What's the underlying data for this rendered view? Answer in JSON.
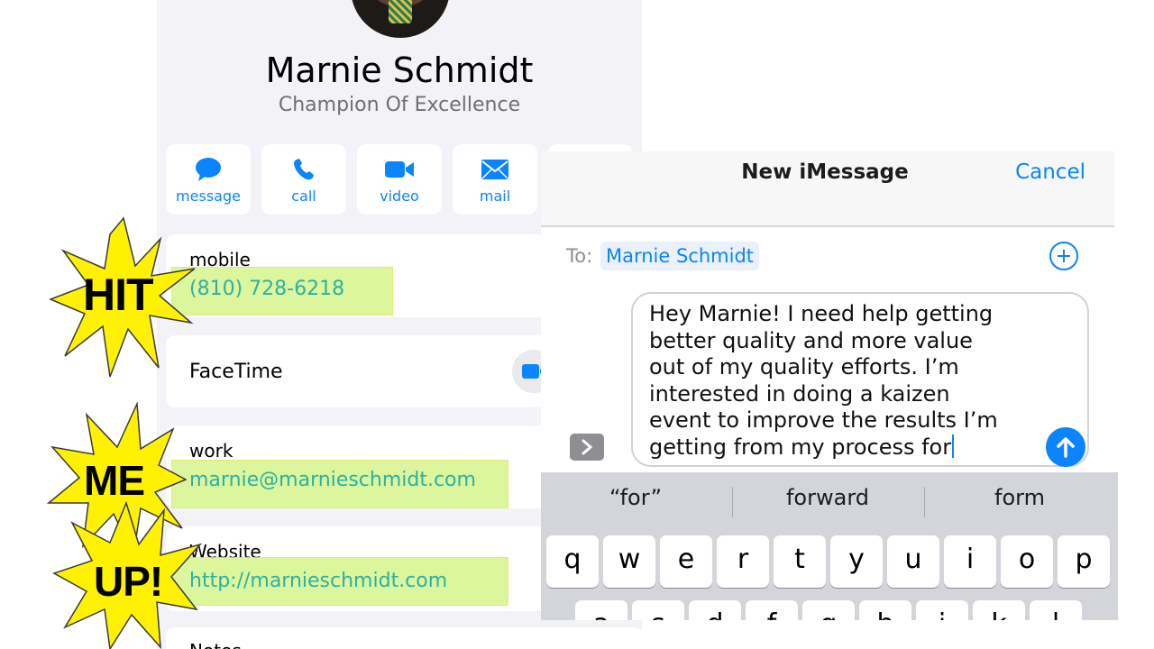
{
  "contact": {
    "name": "Marnie  Schmidt",
    "subtitle": "Champion Of Excellence",
    "actions": [
      {
        "label": "message",
        "icon": "message-bubble-icon"
      },
      {
        "label": "call",
        "icon": "phone-icon"
      },
      {
        "label": "video",
        "icon": "video-camera-icon"
      },
      {
        "label": "mail",
        "icon": "envelope-icon"
      }
    ],
    "mobile": {
      "label": "mobile",
      "value": "(810) 728-6218"
    },
    "facetime": {
      "label": "FaceTime"
    },
    "work": {
      "label": "work",
      "value": "marnie@marnieschmidt.com"
    },
    "website": {
      "label": "Website",
      "value": "http://marnieschmidt.com"
    },
    "notes": {
      "label": "Notes"
    }
  },
  "callouts": [
    "HIT",
    "ME",
    "UP!"
  ],
  "imessage": {
    "title": "New iMessage",
    "cancel": "Cancel",
    "to_label": "To:",
    "recipient": "Marnie  Schmidt",
    "message": "Hey Marnie!  I need help getting\nbetter quality and more value\nout of my quality efforts.  I’m\ninterested in doing a kaizen\nevent to improve the results I’m\ngetting from my process for"
  },
  "keyboard": {
    "suggestions": [
      "“for”",
      "forward",
      "form"
    ],
    "row1": [
      "q",
      "w",
      "e",
      "r",
      "t",
      "y",
      "u",
      "i",
      "o",
      "p"
    ],
    "row2": [
      "a",
      "s",
      "d",
      "f",
      "g",
      "h",
      "j",
      "k",
      "l"
    ]
  },
  "colors": {
    "ios_blue": "#0a84ff",
    "value_teal": "#2bb1a3",
    "highlight": "#d7f58d",
    "burst_yellow": "#fff200"
  }
}
